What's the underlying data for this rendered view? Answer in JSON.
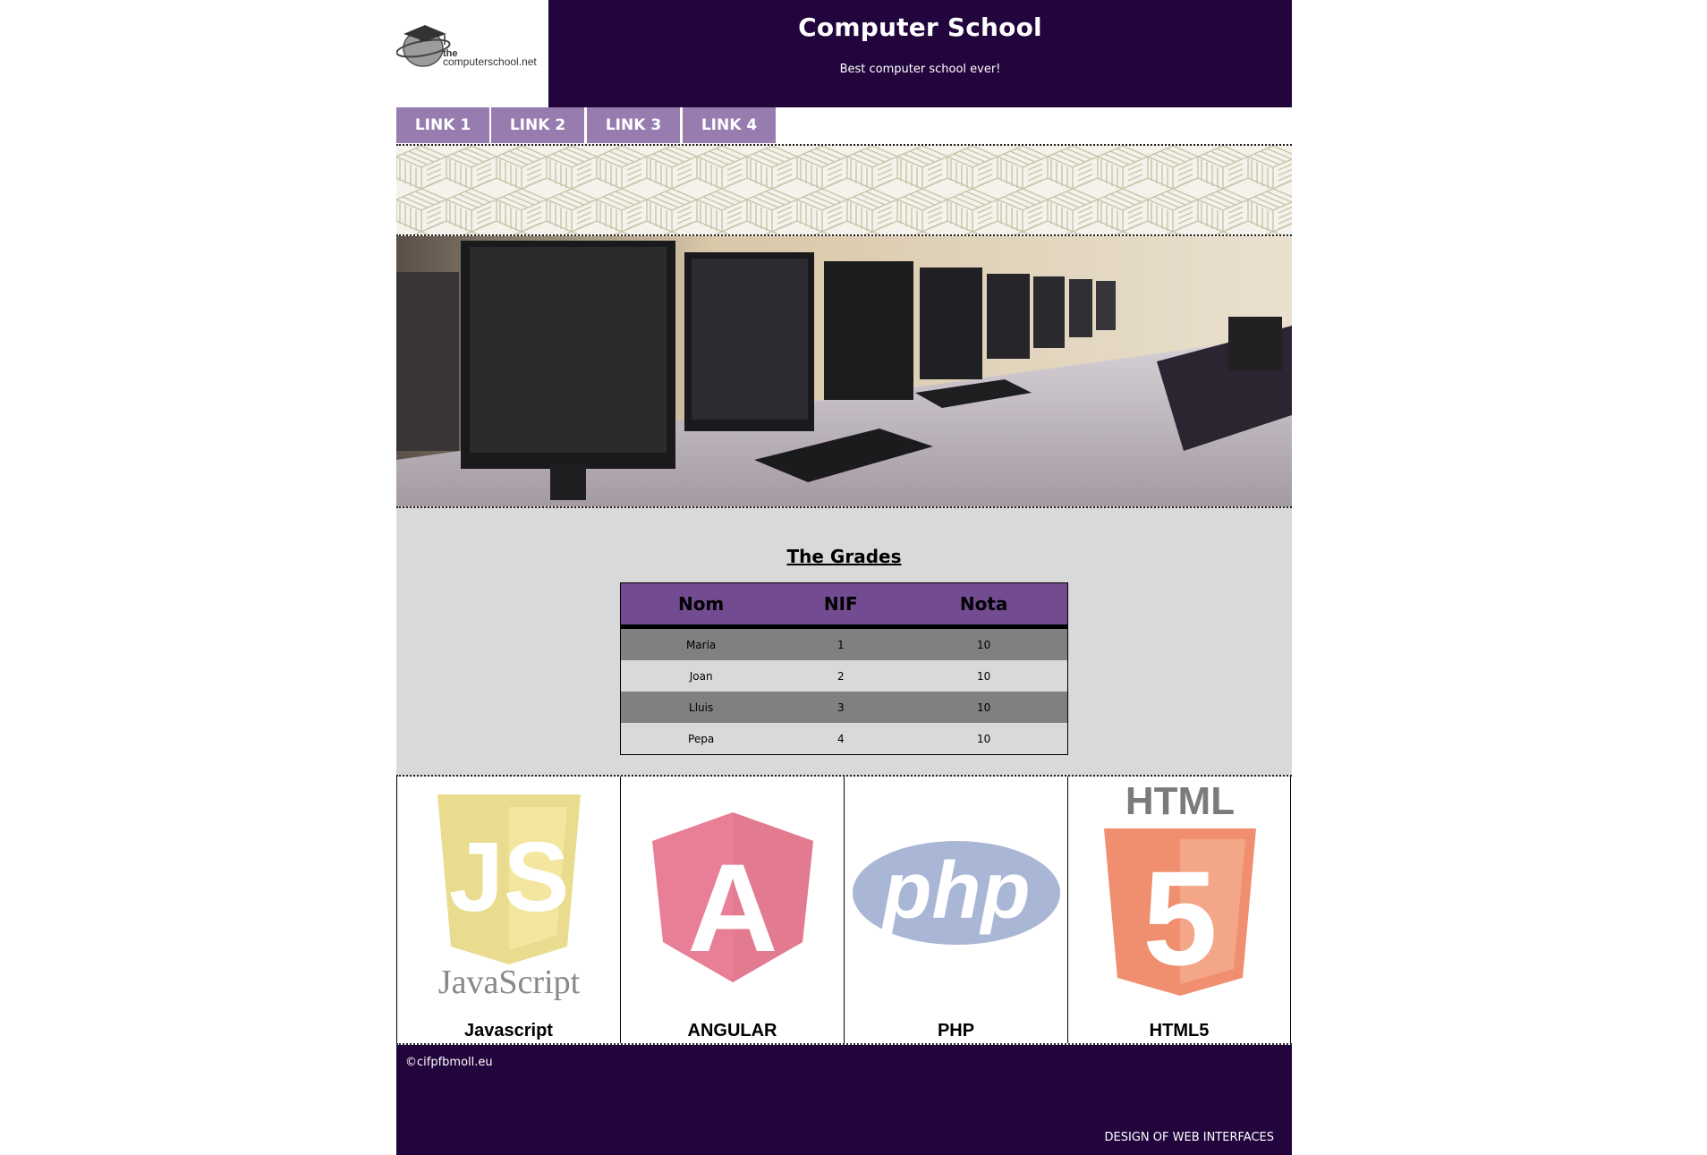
{
  "header": {
    "logo_text_top": "the",
    "logo_text_bottom": "computerschool.net",
    "title": "Computer School",
    "subtitle": "Best computer school ever!"
  },
  "nav": {
    "links": [
      "LINK 1",
      "LINK 2",
      "LINK 3",
      "LINK 4"
    ]
  },
  "grades": {
    "title": "The Grades",
    "columns": [
      "Nom",
      "NIF",
      "Nota"
    ],
    "rows": [
      [
        "Maria",
        "1",
        "10"
      ],
      [
        "Joan",
        "2",
        "10"
      ],
      [
        "Lluis",
        "3",
        "10"
      ],
      [
        "Pepa",
        "4",
        "10"
      ]
    ]
  },
  "tech": {
    "cards": [
      {
        "label": "Javascript",
        "icon": "javascript-logo-icon",
        "logo_text": "JavaScript",
        "badge": "JS"
      },
      {
        "label": "ANGULAR",
        "icon": "angular-logo-icon",
        "badge": "A"
      },
      {
        "label": "PHP",
        "icon": "php-logo-icon",
        "badge": "php"
      },
      {
        "label": "HTML5",
        "icon": "html5-logo-icon",
        "logo_text": "HTML",
        "badge": "5"
      }
    ]
  },
  "footer": {
    "copyright": "©cifpfbmoll.eu",
    "credit": "DESIGN OF WEB INTERFACES"
  },
  "colors": {
    "header_bg": "#22053c",
    "nav_bg": "#977cb0",
    "table_header": "#724b91",
    "grades_bg": "#d9d9d9"
  }
}
